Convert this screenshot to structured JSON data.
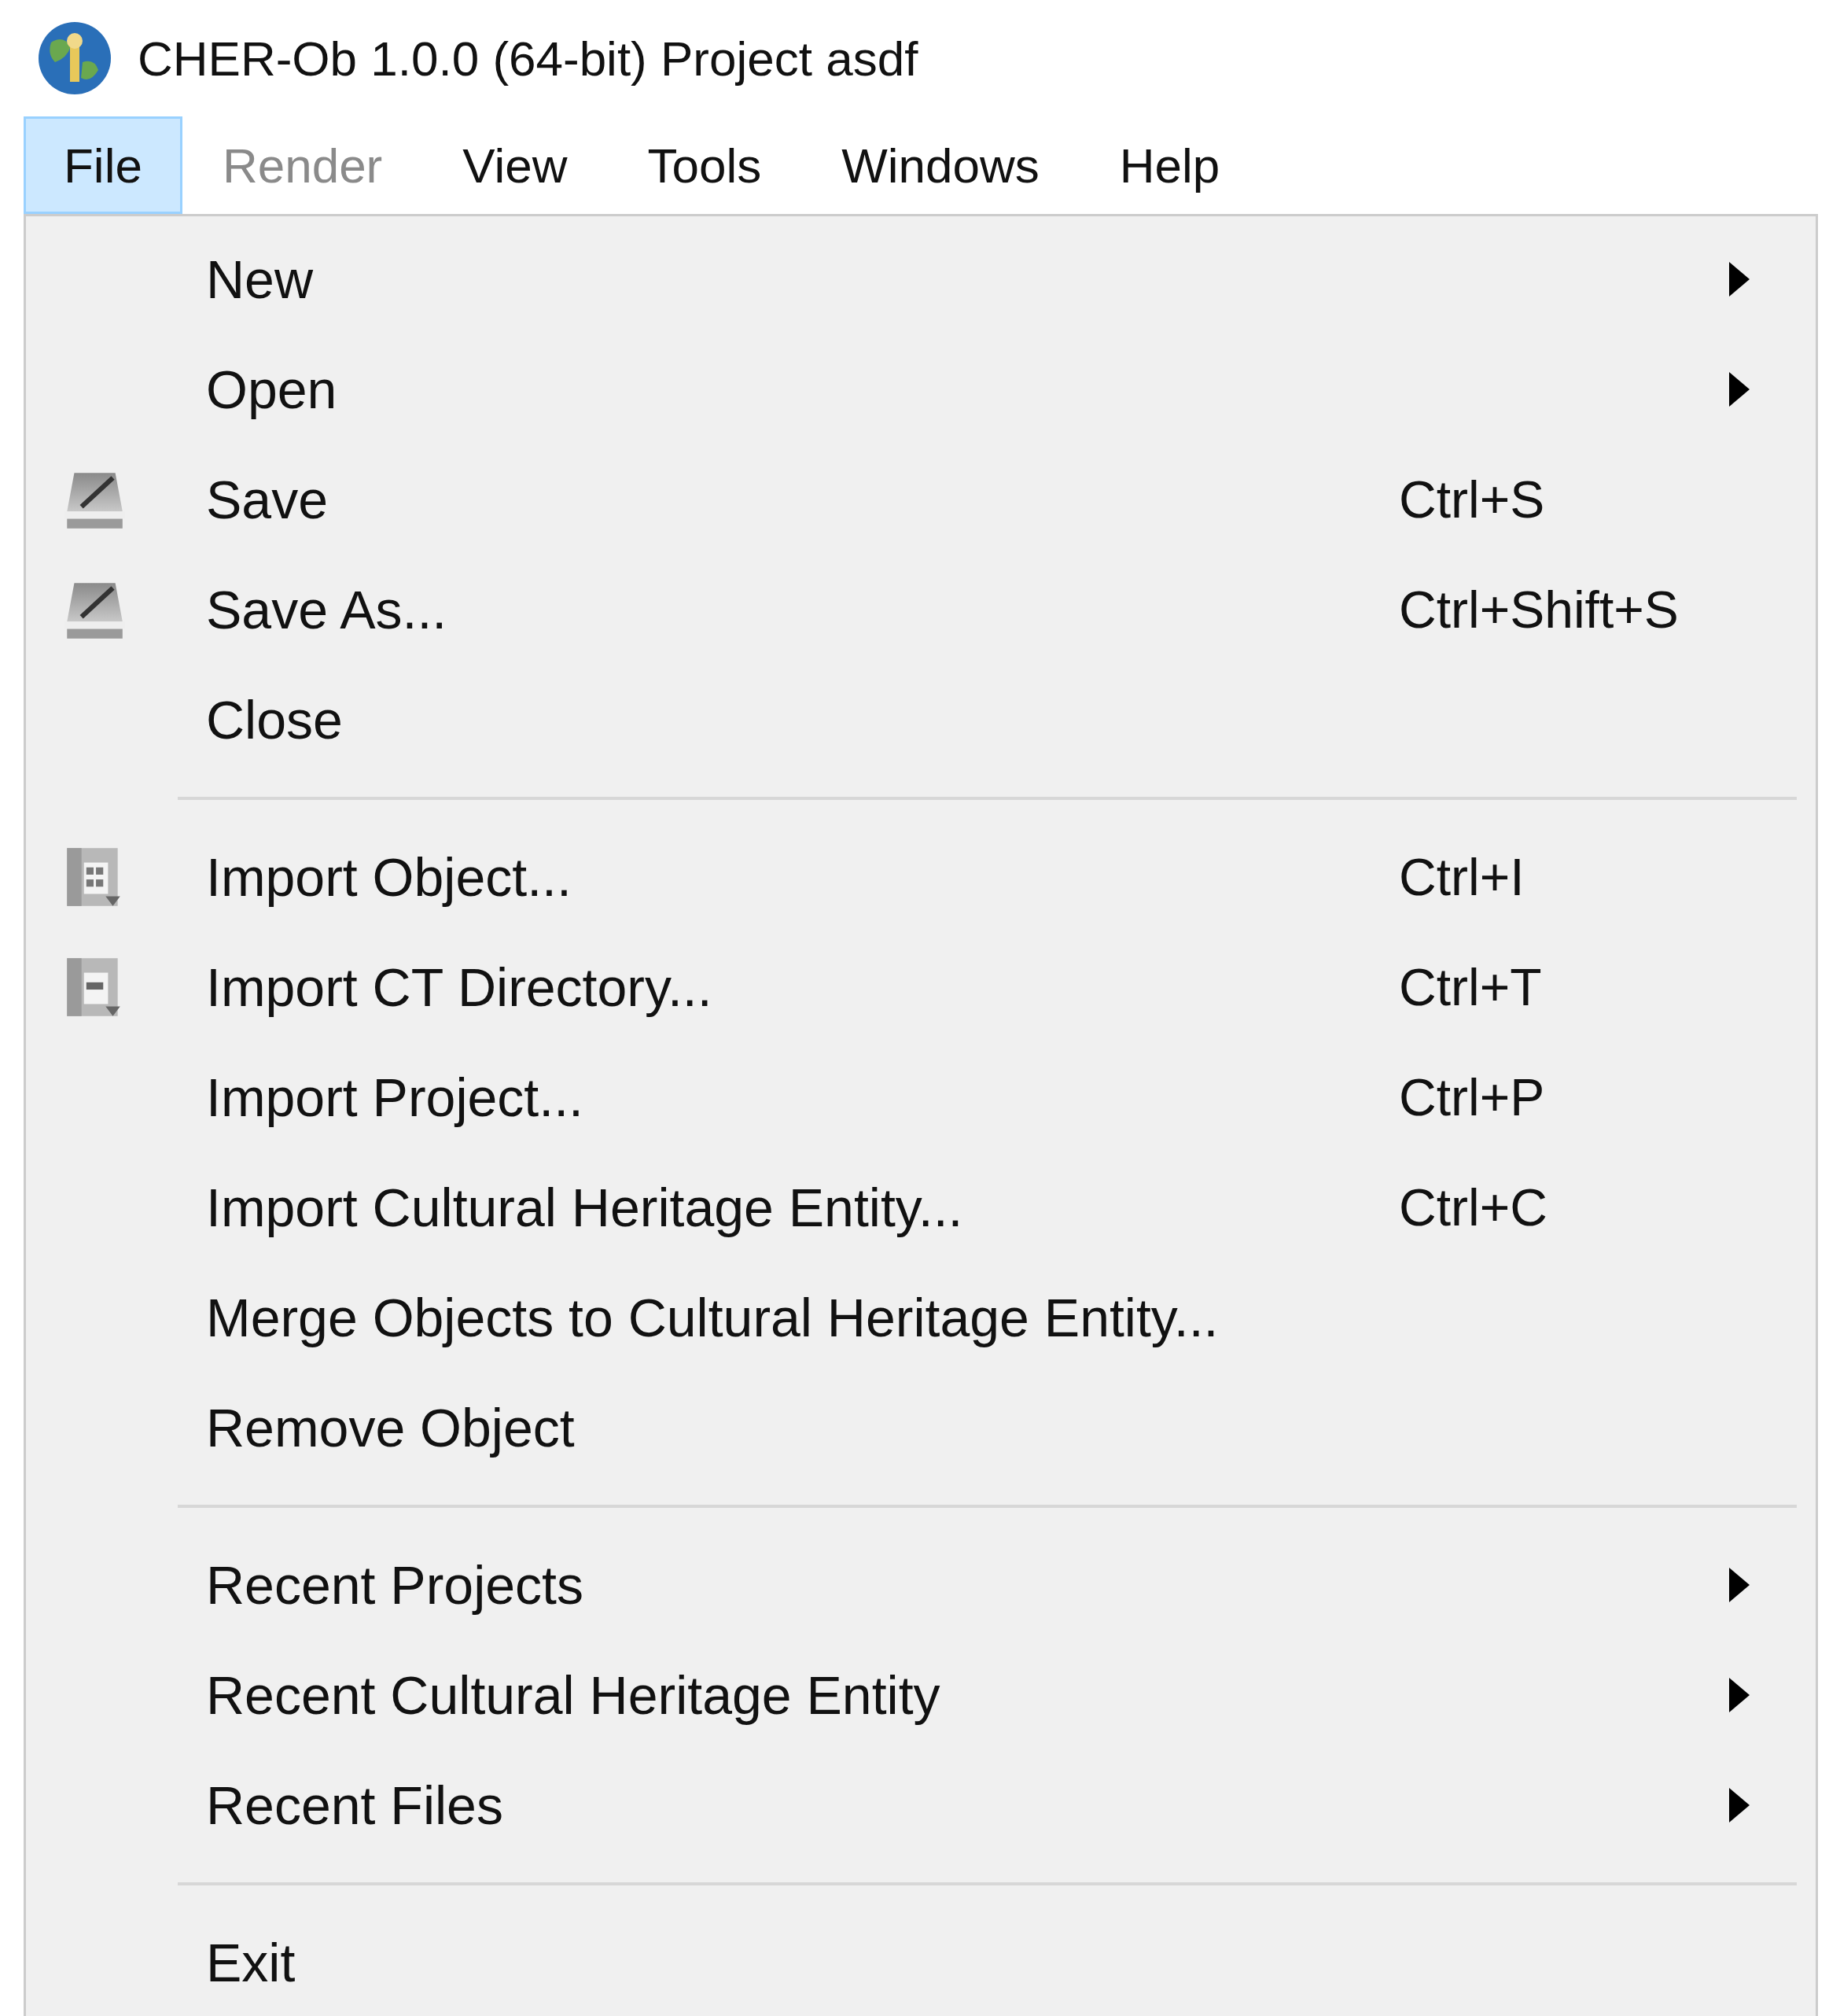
{
  "window": {
    "title": "CHER-Ob 1.0.0 (64-bit) Project asdf"
  },
  "menubar": [
    {
      "label": "File",
      "selected": true,
      "disabled": false
    },
    {
      "label": "Render",
      "selected": false,
      "disabled": true
    },
    {
      "label": "View",
      "selected": false,
      "disabled": false
    },
    {
      "label": "Tools",
      "selected": false,
      "disabled": false
    },
    {
      "label": "Windows",
      "selected": false,
      "disabled": false
    },
    {
      "label": "Help",
      "selected": false,
      "disabled": false
    }
  ],
  "file_menu": {
    "items": [
      {
        "kind": "item",
        "label": "New",
        "submenu": true
      },
      {
        "kind": "item",
        "label": "Open",
        "submenu": true
      },
      {
        "kind": "disk",
        "label": "Save",
        "shortcut": "Ctrl+S",
        "submenu": false
      },
      {
        "kind": "disk",
        "label": "Save As...",
        "shortcut": "Ctrl+Shift+S",
        "submenu": false
      },
      {
        "kind": "item",
        "label": "Close",
        "submenu": false
      },
      {
        "kind": "separator"
      },
      {
        "kind": "object",
        "label": "Import Object...",
        "shortcut": "Ctrl+I",
        "submenu": false
      },
      {
        "kind": "ct",
        "label": "Import CT Directory...",
        "shortcut": "Ctrl+T",
        "submenu": false
      },
      {
        "kind": "item",
        "label": "Import Project...",
        "shortcut": "Ctrl+P",
        "submenu": false
      },
      {
        "kind": "item",
        "label": "Import Cultural Heritage Entity...",
        "shortcut": "Ctrl+C",
        "submenu": false
      },
      {
        "kind": "item",
        "label": "Merge Objects to Cultural Heritage Entity...",
        "submenu": false
      },
      {
        "kind": "item",
        "label": "Remove Object",
        "submenu": false
      },
      {
        "kind": "separator"
      },
      {
        "kind": "item",
        "label": "Recent Projects",
        "submenu": true
      },
      {
        "kind": "item",
        "label": "Recent Cultural Heritage Entity",
        "submenu": true
      },
      {
        "kind": "item",
        "label": "Recent Files",
        "submenu": true
      },
      {
        "kind": "separator"
      },
      {
        "kind": "item",
        "label": "Exit",
        "submenu": false
      }
    ]
  }
}
